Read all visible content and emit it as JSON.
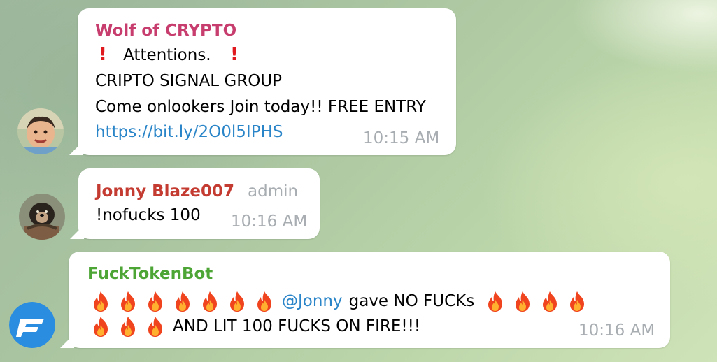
{
  "messages": [
    {
      "sender": "Wolf of CRYPTO",
      "sender_color": "#c73d6e",
      "lines": {
        "attention": "Attentions.",
        "group": "CRIPTO SIGNAL GROUP",
        "invite": "Come onlookers Join today!! FREE ENTRY",
        "link": "https://bit.ly/2O0l5IPHS"
      },
      "time": "10:15 AM",
      "avatar_icon": "child-photo-avatar"
    },
    {
      "sender": "Jonny Blaze007",
      "sender_color": "#c43b31",
      "role": "admin",
      "text": "!nofucks 100",
      "time": "10:16 AM",
      "avatar_icon": "dog-photo-avatar"
    },
    {
      "sender": "FuckTokenBot",
      "sender_color": "#4da536",
      "mention": "@Jonny",
      "text_mid": "gave NO FUCKs",
      "text_end": "AND LIT 100 FUCKS ON FIRE!!!",
      "time": "10:16 AM",
      "avatar_icon": "f-logo-avatar",
      "avatar_color": "#2b8de0"
    }
  ],
  "icons": {
    "exclamation": "red-exclamation-icon",
    "fire": "fire-icon"
  }
}
